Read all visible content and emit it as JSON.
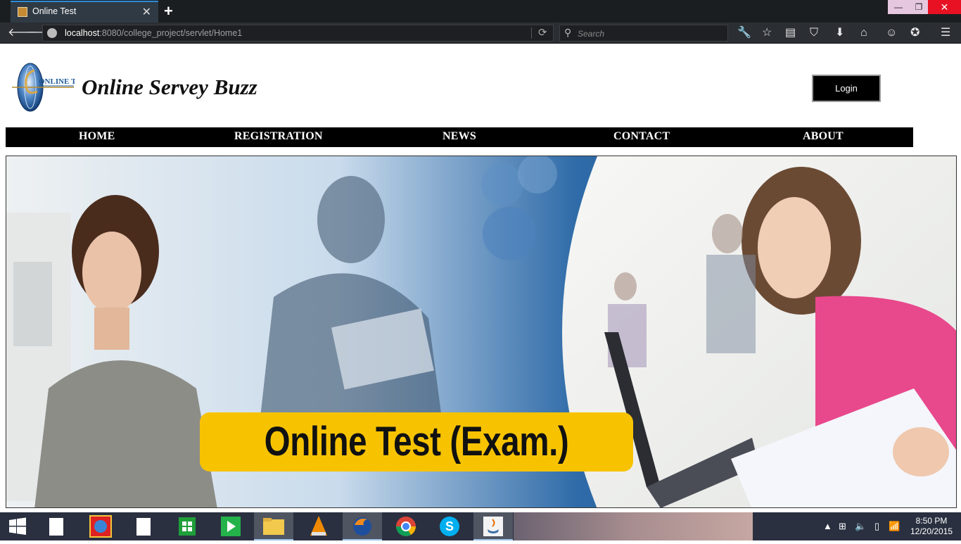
{
  "browser": {
    "tab_title": "Online Test",
    "url_host": "localhost",
    "url_path": ":8080/college_project/servlet/Home1",
    "search_placeholder": "Search"
  },
  "header": {
    "logo_text": "ONLINE TEST",
    "site_title": "Online Servey Buzz",
    "login_label": "Login"
  },
  "menu": {
    "items": [
      {
        "label": "HOME"
      },
      {
        "label": "REGISTRATION"
      },
      {
        "label": "NEWS"
      },
      {
        "label": "CONTACT"
      },
      {
        "label": "ABOUT"
      }
    ]
  },
  "banner": {
    "headline": "Online Test (Exam.)"
  },
  "taskbar": {
    "time": "8:50 PM",
    "date": "12/20/2015"
  },
  "colors": {
    "accent_blue": "#1e5a99",
    "banner_yellow": "#f7c300",
    "menu_bg": "#000000"
  }
}
